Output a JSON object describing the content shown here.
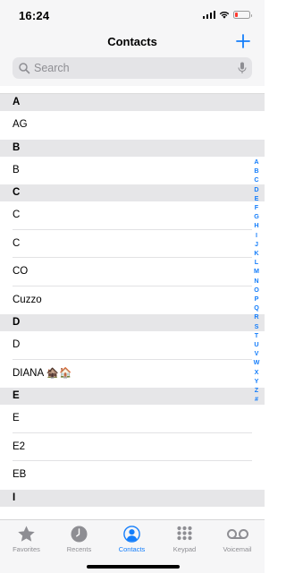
{
  "status_bar": {
    "time": "16:24",
    "battery_color": "#ff3b30"
  },
  "nav": {
    "title": "Contacts",
    "add_icon": "plus-icon"
  },
  "search": {
    "placeholder": "Search",
    "value": ""
  },
  "accent_color": "#147efb",
  "sections": [
    {
      "letter": "A",
      "contacts": [
        "AG"
      ]
    },
    {
      "letter": "B",
      "contacts": [
        "B"
      ]
    },
    {
      "letter": "C",
      "contacts": [
        "C",
        "C",
        "CO",
        "Cuzzo"
      ]
    },
    {
      "letter": "D",
      "contacts": [
        "D",
        "DIANA 🏚️🏠"
      ]
    },
    {
      "letter": "E",
      "contacts": [
        "E",
        "E2",
        "EB"
      ]
    },
    {
      "letter": "I",
      "contacts": []
    }
  ],
  "index_letters": [
    "A",
    "B",
    "C",
    "D",
    "E",
    "F",
    "G",
    "H",
    "I",
    "J",
    "K",
    "L",
    "M",
    "N",
    "O",
    "P",
    "Q",
    "R",
    "S",
    "T",
    "U",
    "V",
    "W",
    "X",
    "Y",
    "Z",
    "#"
  ],
  "tabs": [
    {
      "id": "favorites",
      "label": "Favorites",
      "icon": "star-icon",
      "active": false
    },
    {
      "id": "recents",
      "label": "Recents",
      "icon": "clock-icon",
      "active": false
    },
    {
      "id": "contacts",
      "label": "Contacts",
      "icon": "person-circle-icon",
      "active": true
    },
    {
      "id": "keypad",
      "label": "Keypad",
      "icon": "keypad-icon",
      "active": false
    },
    {
      "id": "voicemail",
      "label": "Voicemail",
      "icon": "voicemail-icon",
      "active": false
    }
  ]
}
